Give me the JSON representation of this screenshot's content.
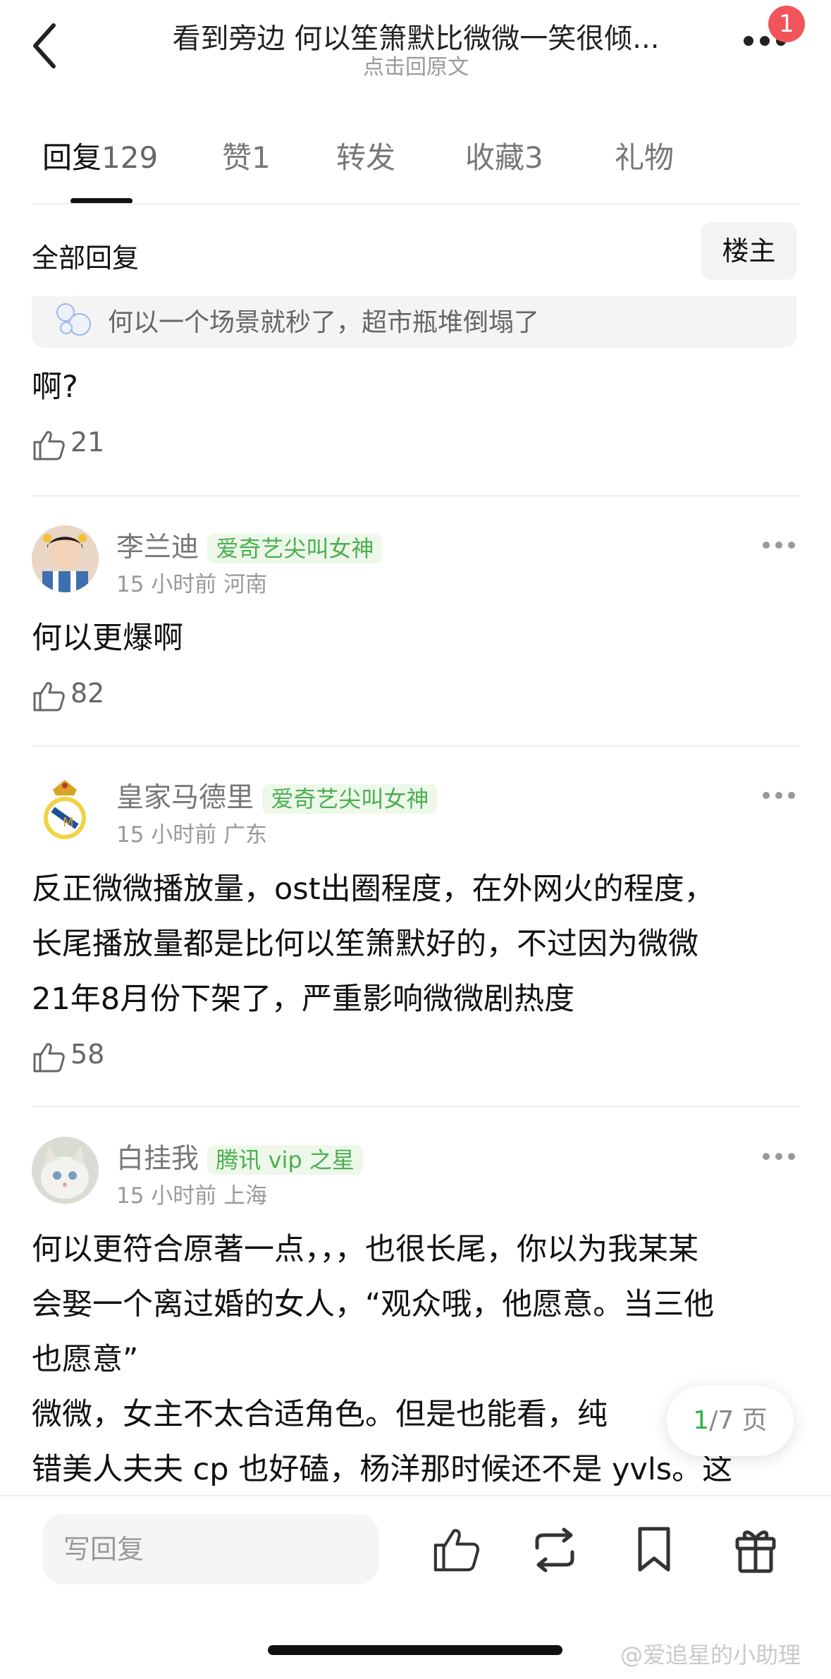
{
  "header": {
    "title": "看到旁边 何以笙箫默比微微一笑很倾...",
    "subtitle": "点击回原文",
    "badge_count": "1"
  },
  "tabs": [
    {
      "label": "回复",
      "count": "129"
    },
    {
      "label": "赞",
      "count": "1"
    },
    {
      "label": "转发",
      "count": ""
    },
    {
      "label": "收藏",
      "count": "3"
    },
    {
      "label": "礼物",
      "count": ""
    }
  ],
  "section": {
    "title": "全部回复",
    "owner_button": "楼主"
  },
  "quote": {
    "text": "何以一个场景就秒了，超市瓶堆倒塌了"
  },
  "first_reply": {
    "text": "啊?",
    "likes": "21"
  },
  "comments": [
    {
      "username": "李兰迪",
      "tag": "爱奇艺尖叫女神",
      "meta": "15 小时前  河南",
      "lines": [
        "何以更爆啊"
      ],
      "likes": "82"
    },
    {
      "username": "皇家马德里",
      "tag": "爱奇艺尖叫女神",
      "meta": "15 小时前  广东",
      "lines": [
        "反正微微播放量，ost出圈程度，在外网火的程度，",
        "长尾播放量都是比何以笙箫默好的，不过因为微微",
        "21年8月份下架了，严重影响微微剧热度"
      ],
      "likes": "58"
    },
    {
      "username": "白挂我",
      "tag": "腾讯 vip 之星",
      "meta": "15 小时前  上海",
      "lines": [
        "何以更符合原著一点，，，也很长尾，你以为我某某",
        "会娶一个离过婚的女人，“观众哦，他愿意。当三他",
        "也愿意”",
        "微微，女主不太合适角色。但是也能看，纯",
        "错美人夫夫 cp 也好磕，杨洋那时候还不是 yvls。这"
      ],
      "likes": ""
    }
  ],
  "pager": {
    "current": "1",
    "total_text": "/7 页"
  },
  "bottom": {
    "reply_placeholder": "写回复"
  },
  "watermark": "@爱追星的小助理",
  "colors": {
    "accent_green": "#31b34a",
    "tag_green": "#4caf50",
    "badge_red": "#f2545b"
  },
  "icons": [
    "back-arrow-icon",
    "more-dots-icon",
    "thumbs-up-icon",
    "repost-icon",
    "bookmark-icon",
    "gift-icon",
    "bubble-icon"
  ]
}
